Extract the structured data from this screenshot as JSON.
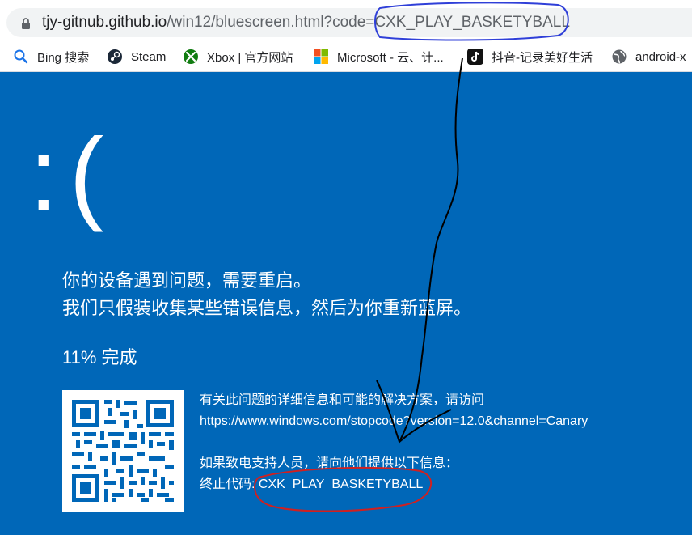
{
  "browser": {
    "url_host": "tjy-gitnub.github.io",
    "url_path": "/win12/bluescreen.html?code=CXK_PLAY_BASKETYBALL",
    "bookmarks": [
      {
        "label": "Bing 搜索",
        "icon": "search-icon"
      },
      {
        "label": "Steam",
        "icon": "steam-icon"
      },
      {
        "label": "Xbox | 官方网站",
        "icon": "xbox-icon"
      },
      {
        "label": "Microsoft - 云、计...",
        "icon": "microsoft-icon"
      },
      {
        "label": "抖音-记录美好生活",
        "icon": "tiktok-icon"
      },
      {
        "label": "android-x",
        "icon": "globe-icon"
      }
    ]
  },
  "bsod": {
    "face": ":(",
    "line1": "你的设备遇到问题，需要重启。",
    "line2": "我们只假装收集某些错误信息，然后为你重新蓝屏。",
    "progress": "11% 完成",
    "progress_value": 0.11,
    "info_line1": "有关此问题的详细信息和可能的解决方案，请访问",
    "info_url": "https://www.windows.com/stopcode?version=12.0&channel=Canary",
    "support_line": "如果致电支持人员，请向他们提供以下信息：",
    "stop_code_label": "终止代码:",
    "stop_code": "CXK_PLAY_BASKETYBALL",
    "background_color": "#0067b8"
  },
  "annotations": {
    "url_circle_color": "#2f3fd8",
    "arrow_color": "#000000",
    "code_circle_color": "#d02020"
  }
}
